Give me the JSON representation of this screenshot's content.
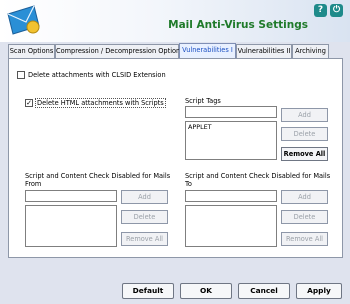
{
  "window": {
    "title": "Mail Anti-Virus Settings",
    "help_label": "?",
    "power_label": "⏻"
  },
  "tabs": [
    {
      "label": "Scan Options"
    },
    {
      "label": "Compression / Decompression Options"
    },
    {
      "label": "Vulnerabilities I"
    },
    {
      "label": "Vulnerabilities II"
    },
    {
      "label": "Archiving"
    }
  ],
  "panel": {
    "clsid_checkbox_label": "Delete attachments with CLSID Extension",
    "html_checkbox_label": "Delete HTML attachments with Scripts",
    "script_tags_label": "Script Tags",
    "script_tags_input": "",
    "script_tags_list": [
      "APPLET"
    ],
    "add_label": "Add",
    "delete_label": "Delete",
    "remove_all_label": "Remove All",
    "from_label_line1": "Script and Content Check Disabled for Mails",
    "from_label_line2": "From",
    "to_label_line1": "Script and Content Check Disabled for Mails",
    "to_label_line2": "To"
  },
  "footer": {
    "default_label": "Default",
    "ok_label": "OK",
    "cancel_label": "Cancel",
    "apply_label": "Apply"
  }
}
